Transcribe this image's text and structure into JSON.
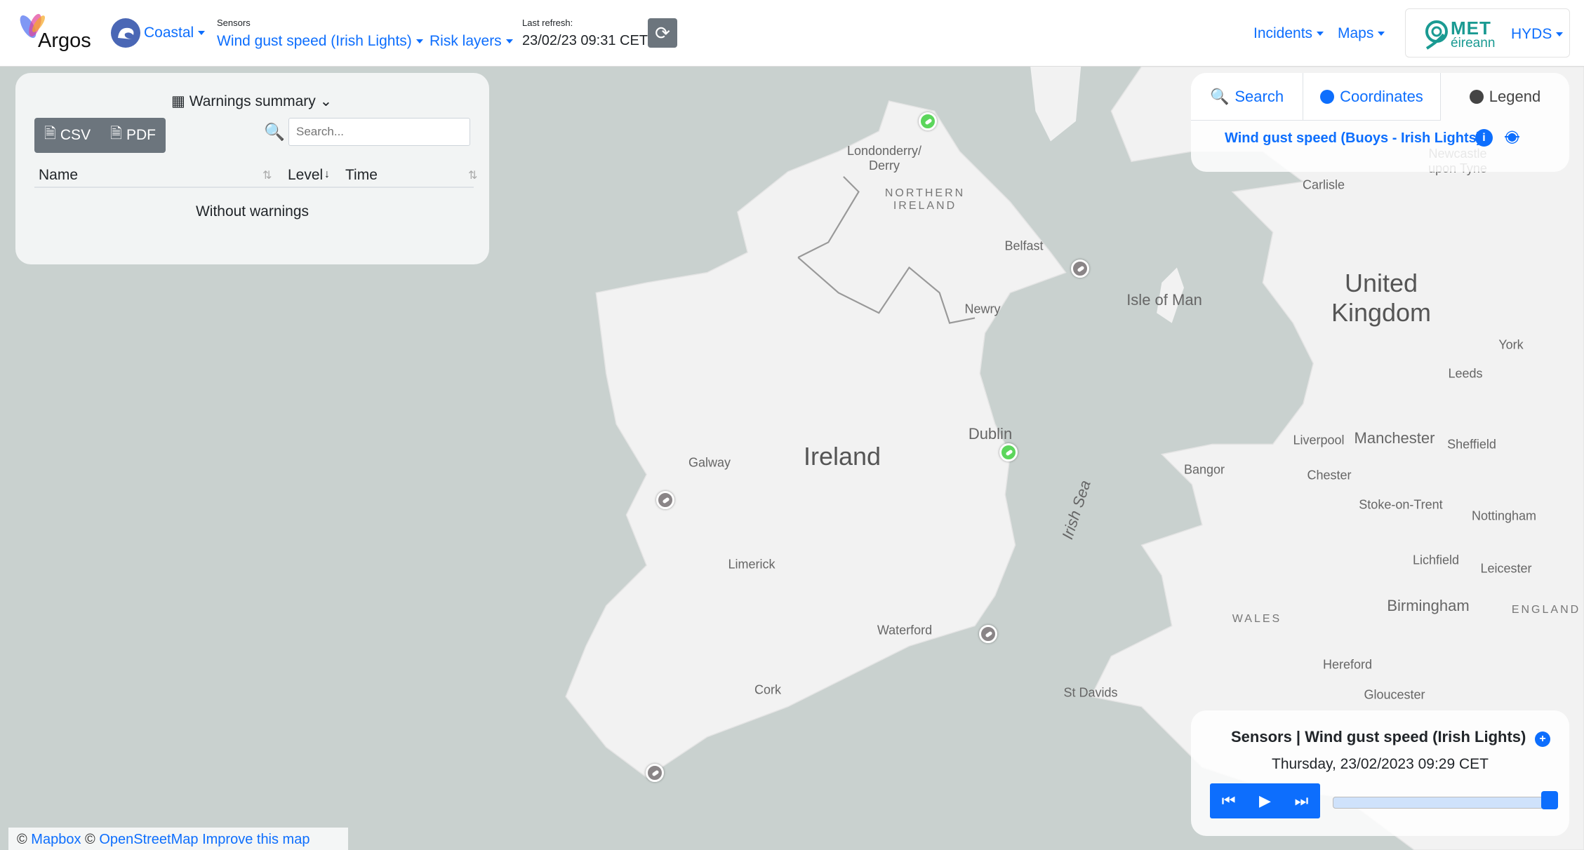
{
  "header": {
    "app_name": "Argos",
    "profile": "Coastal",
    "sensors_label": "Sensors",
    "sensor_select": "Wind gust speed (Irish Lights)",
    "risk_layers": "Risk layers",
    "last_refresh_label": "Last refresh:",
    "last_refresh": "23/02/23 09:31 CET",
    "incidents": "Incidents",
    "maps": "Maps",
    "org_logo_top": "MET",
    "org_logo_bottom": "éireann",
    "user": "HYDS"
  },
  "warnings": {
    "title": "Warnings summary",
    "csv": "CSV",
    "pdf": "PDF",
    "search_placeholder": "Search...",
    "columns": [
      "Name",
      "Level",
      "Time"
    ],
    "empty": "Without warnings"
  },
  "tabs": {
    "search": "Search",
    "coordinates": "Coordinates",
    "legend": "Legend",
    "active": "Legend",
    "layer": "Wind gust speed (Buoys - Irish Lights)"
  },
  "player": {
    "title": "Sensors | Wind gust speed (Irish Lights)",
    "datetime": "Thursday, 23/02/2023 09:29 CET",
    "progress": 1.0
  },
  "attribution": {
    "mapbox": "Mapbox",
    "osm": "OpenStreetMap",
    "improve": "Improve this map"
  },
  "map": {
    "labels": [
      "Londonderry/\nDerry",
      "NORTHERN\nIRELAND",
      "Belfast",
      "Newry",
      "Isle of Man",
      "United\nKingdom",
      "Carlisle",
      "Newcastle\nupon Tyne",
      "York",
      "Leeds",
      "Ireland",
      "Dublin",
      "Galway",
      "Liverpool",
      "Manchester",
      "Sheffield",
      "Bangor",
      "Chester",
      "Irish Sea",
      "Stoke-on-Trent",
      "Nottingham",
      "Limerick",
      "Lichfield",
      "Leicester",
      "Birmingham",
      "WALES",
      "ENGLAND",
      "Waterford",
      "Hereford",
      "Gloucester",
      "Cork",
      "St Davids"
    ],
    "marker_colors": {
      "ok": "#5cd65c",
      "no_data": "#8a8587"
    }
  },
  "colors": {
    "accent": "#0d6efd",
    "sea": "#c9d1cf",
    "land": "#f2f2f2"
  }
}
